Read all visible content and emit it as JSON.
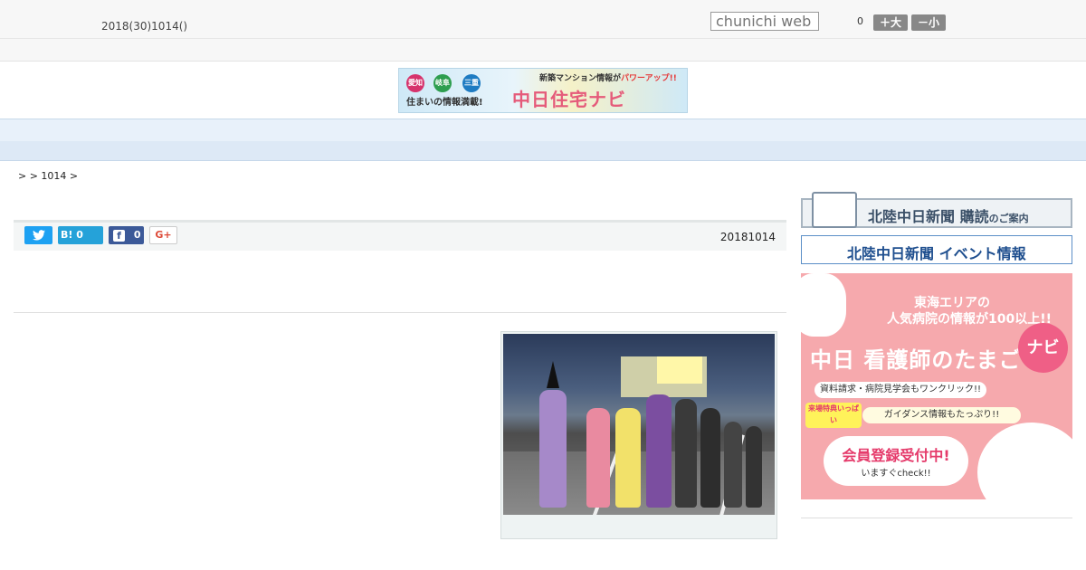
{
  "header": {
    "date": "2018(30)1014()",
    "search_placeholder": "chunichi web",
    "count": "0",
    "font_large": "＋大",
    "font_small": "－小"
  },
  "banner": {
    "badges": [
      "愛知",
      "岐阜",
      "三重"
    ],
    "subtitle": "住まいの情報満載!",
    "top_prefix": "新築マンション情報が",
    "top_highlight": "パワーアップ!!",
    "brand": "中日住宅ナビ"
  },
  "nav": {
    "items": [
      "",
      "",
      "",
      "",
      "",
      "",
      "",
      "",
      ""
    ]
  },
  "breadcrumb": ">  > 1014 >",
  "article": {
    "date": "20181014",
    "hatena_count": "0",
    "facebook_count": "0",
    "twitter_label": "",
    "gplus_label": "G+"
  },
  "sidebar": {
    "subscribe_main": "北陸中日新聞 購読",
    "subscribe_small": "のご案内",
    "events_label": "北陸中日新聞 イベント情報",
    "ad": {
      "line1": "東海エリアの",
      "line2": "人気病院の情報が100以上!!",
      "title": "中日 看護師のたまご",
      "navi": "ナビ",
      "pill1": "資料請求・病院見学会もワンクリック!!",
      "tag": "来場特典いっぱい",
      "pill2": "ガイダンス情報もたっぷり!!",
      "bubble_main": "会員登録受付中!",
      "bubble_sub": "いますぐcheck!!"
    }
  },
  "colors": {
    "nav_bg": "#e8f1fa",
    "twitter": "#1da1f2",
    "hatena": "#25a2d9",
    "facebook": "#3b5998",
    "ad_bg": "#f6a9ad"
  }
}
